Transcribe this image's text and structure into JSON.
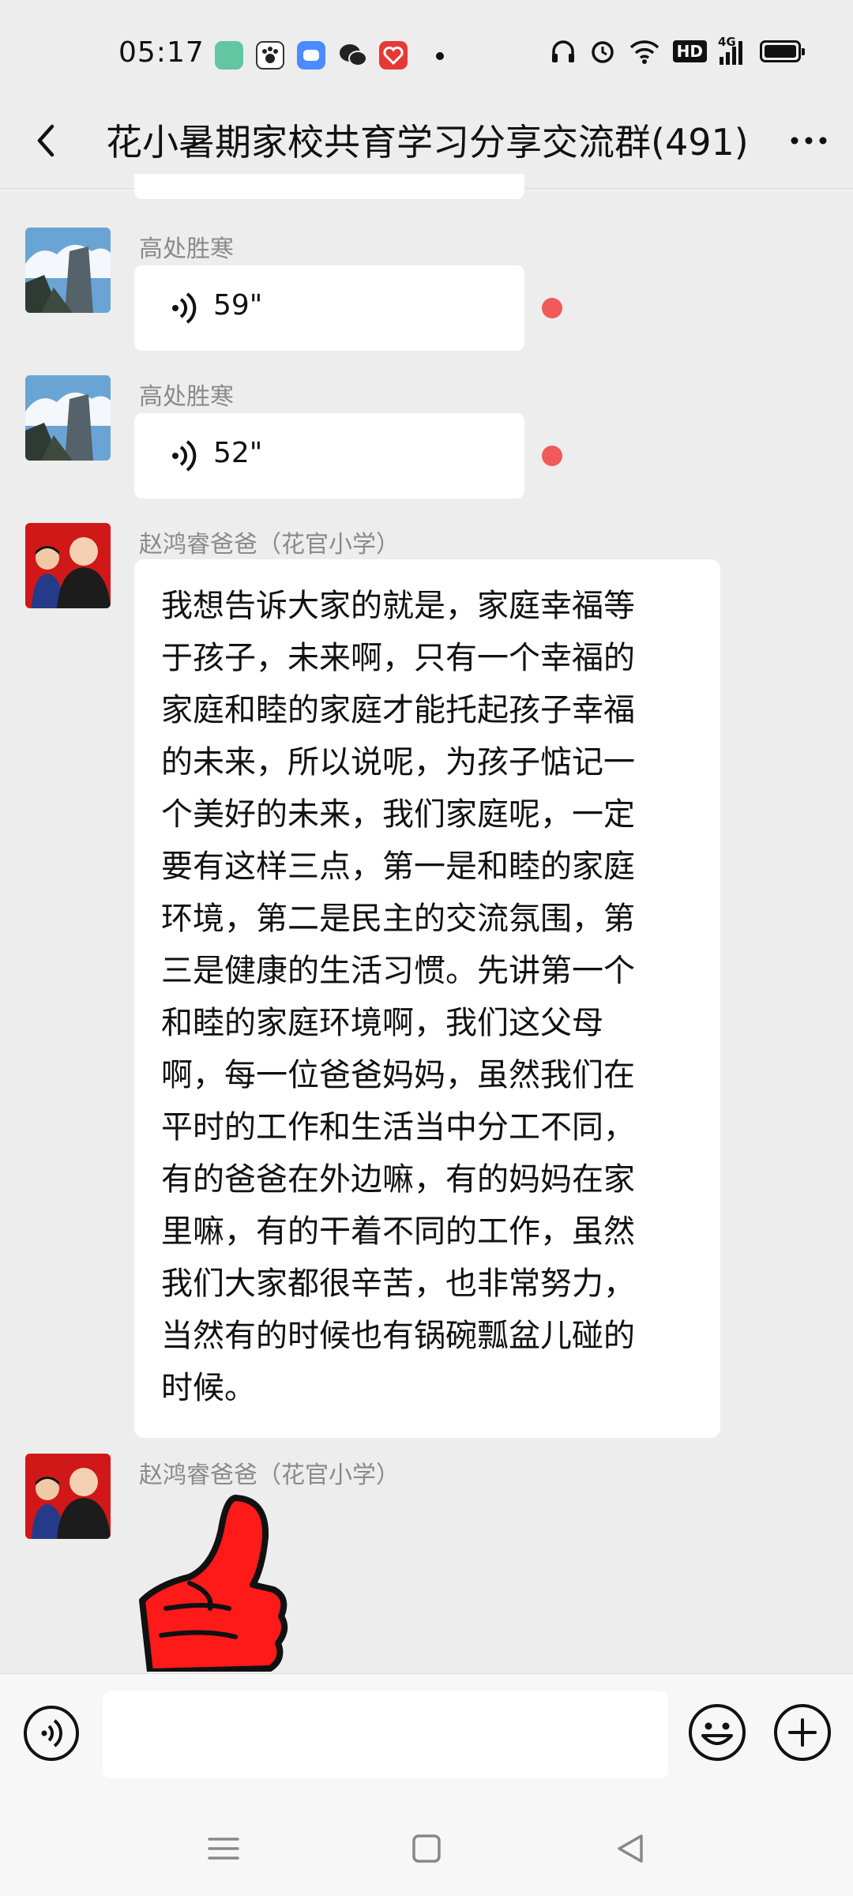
{
  "status_bar": {
    "time": "05:17",
    "app_icons": [
      "mint-app-icon",
      "paw-app-icon",
      "blue-app-icon",
      "wechat-icon",
      "red-app-icon"
    ],
    "indicators": [
      "headphones-icon",
      "alarm-icon",
      "wifi-icon",
      "hd-icon",
      "signal-4g-icon",
      "battery-icon"
    ],
    "hd_label": "HD",
    "network_label": "4G"
  },
  "header": {
    "title": "花小暑期家校共育学习分享交流群(491)"
  },
  "messages": [
    {
      "type": "voice",
      "sender": "高处胜寒",
      "duration": "59\"",
      "unread": true
    },
    {
      "type": "voice",
      "sender": "高处胜寒",
      "duration": "52\"",
      "unread": true
    },
    {
      "type": "text",
      "sender": "赵鸿睿爸爸（花官小学）",
      "lines": [
        "我想告诉大家的就是，家庭幸福等",
        "于孩子，未来啊，只有一个幸福的",
        "家庭和睦的家庭才能托起孩子幸福",
        "的未来，所以说呢，为孩子惦记一",
        "个美好的未来，我们家庭呢，一定",
        "要有这样三点，第一是和睦的家庭",
        "环境，第二是民主的交流氛围，第",
        "三是健康的生活习惯。先讲第一个",
        "和睦的家庭环境啊，我们这父母",
        "啊，每一位爸爸妈妈，虽然我们在",
        "平时的工作和生活当中分工不同，",
        "有的爸爸在外边嘛，有的妈妈在家",
        "里嘛，有的干着不同的工作，虽然",
        "我们大家都很辛苦，也非常努力，",
        "当然有的时候也有锅碗瓢盆儿碰的",
        "时候。"
      ]
    },
    {
      "type": "sticker",
      "sender": "赵鸿睿爸爸（花官小学）",
      "sticker": "thumbs-up-sticker"
    }
  ],
  "input_bar": {
    "placeholder": "",
    "colors": {
      "unread_dot": "#f15a5a",
      "background": "#ededed",
      "bubble": "#ffffff",
      "sticker": "#ff1a1a"
    }
  }
}
